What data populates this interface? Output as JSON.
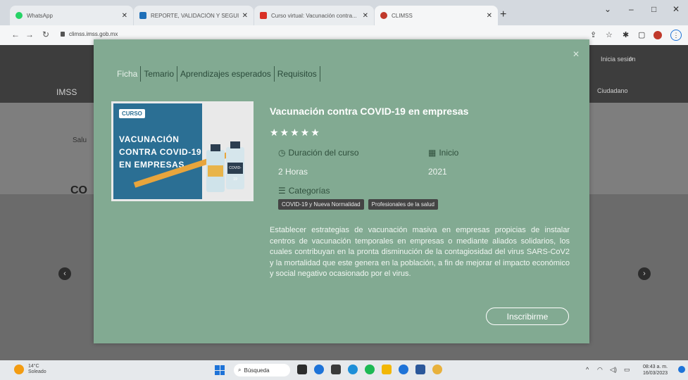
{
  "browser": {
    "tabs": [
      {
        "label": "WhatsApp",
        "color": "#25d366"
      },
      {
        "label": "REPORTE, VALIDACIÓN Y SEGUI...",
        "color": "#1e6fb8"
      },
      {
        "label": "Curso virtual: Vacunación contra...",
        "color": "#d93025"
      },
      {
        "label": "CLIMSS",
        "color": "#c0392b"
      }
    ],
    "url": "climss.imss.gob.mx",
    "window_controls": {
      "minimize": "–",
      "maximize": "□",
      "close": "✕"
    }
  },
  "site": {
    "left_text_1": "Salu",
    "left_text_2": "CO",
    "header_left": "IMSS",
    "header_right": "Ciudadano",
    "header_right2": "Inicia sesión"
  },
  "modal": {
    "tabs": [
      "Ficha",
      "Temario",
      "Aprendizajes esperados",
      "Requisitos"
    ],
    "active_tab": "Ficha",
    "thumbnail": {
      "tag": "CURSO",
      "lines": [
        "VACUNACIÓN",
        "CONTRA COVID-19",
        "EN EMPRESAS"
      ],
      "vial_label": "COVID-19"
    },
    "title": "Vacunación contra COVID-19 en empresas",
    "rating_stars": "★★★★★",
    "duration_label": "Duración del curso",
    "duration_value": "2 Horas",
    "start_label": "Inicio",
    "start_value": "2021",
    "categories_label": "Categorías",
    "categories": [
      "COVID-19 y Nueva Normalidad",
      "Profesionales de la salud"
    ],
    "description": "Establecer estrategias de vacunación masiva en empresas propicias de instalar centros de vacunación temporales en empresas o mediante aliados solidarios, los cuales contribuyan en la pronta disminución de la contagiosidad del virus SARS-CoV2 y la mortalidad que este genera en la población, a fin de mejorar el impacto económico y social negativo ocasionado por el virus.",
    "enroll_button": "Inscribirme",
    "close_symbol": "✕"
  },
  "taskbar": {
    "weather_temp": "14°C",
    "weather_desc": "Soleado",
    "search_label": "Búsqueda",
    "time": "08:43 a. m.",
    "date": "16/03/2023"
  },
  "colors": {
    "modal_bg": "#82aa92",
    "accent": "#2b6f94"
  }
}
